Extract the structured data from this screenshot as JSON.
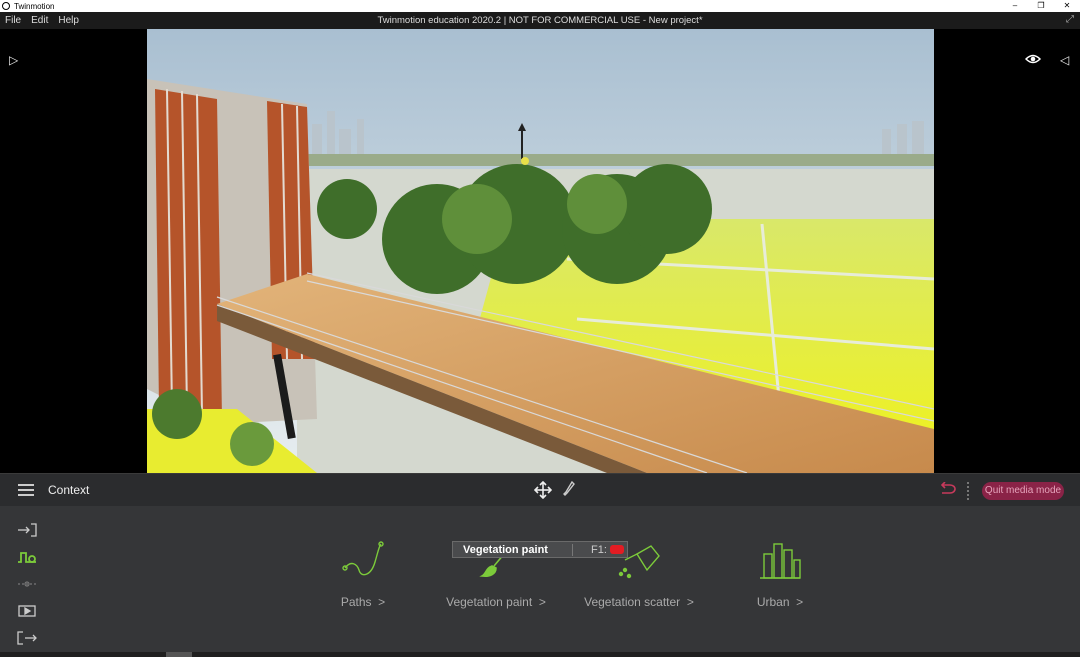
{
  "window": {
    "app_name": "Twinmotion",
    "minimize": "–",
    "restore": "❐",
    "close": "✕"
  },
  "menu": {
    "items": [
      "File",
      "Edit",
      "Help"
    ],
    "doc_title": "Twinmotion education 2020.2 | NOT FOR COMMERCIAL USE - New project*",
    "expand": "⤢"
  },
  "viewport": {
    "left_toggle": "▷",
    "right_toggle": "◁",
    "eye": "◉"
  },
  "toolbar": {
    "context_title": "Context",
    "quit_label": "Quit media mode"
  },
  "tooltip": {
    "title": "Vegetation paint",
    "shortcut": "F1:"
  },
  "categories": [
    {
      "label": "Paths",
      "arrow": ">"
    },
    {
      "label": "Vegetation paint",
      "arrow": ">"
    },
    {
      "label": "Vegetation scatter",
      "arrow": ">"
    },
    {
      "label": "Urban",
      "arrow": ">"
    }
  ],
  "colors": {
    "accent_green": "#7ccb3a",
    "quit_bg": "#8a2347",
    "undo": "#c73a5c"
  }
}
